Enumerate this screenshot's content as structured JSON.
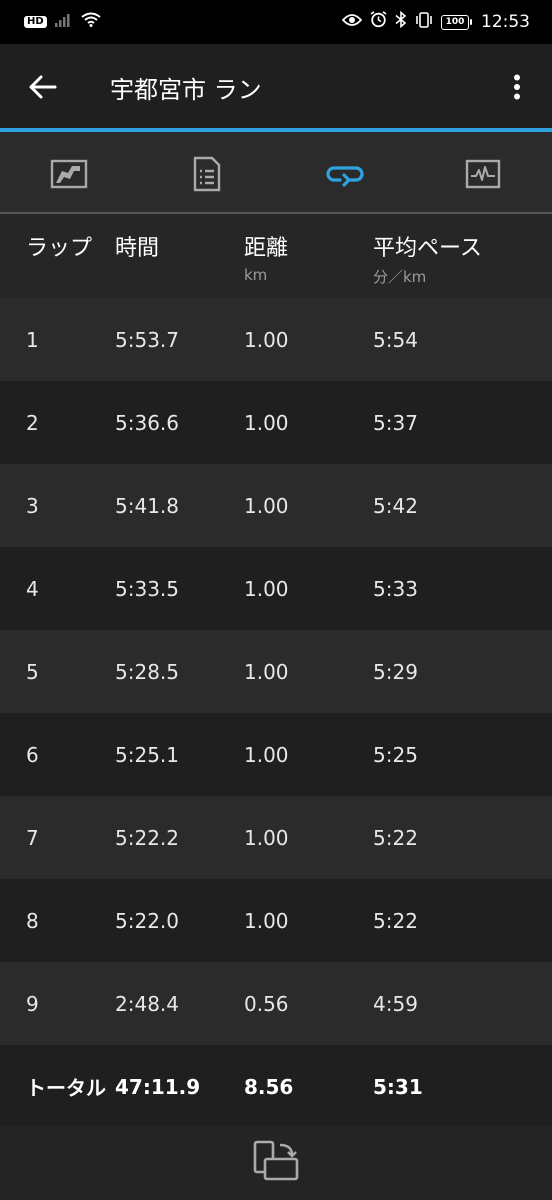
{
  "status_bar": {
    "hd": "HD",
    "battery": "100",
    "time": "12:53"
  },
  "app_bar": {
    "title": "宇都宮市 ラン",
    "icons": [
      "arrow-left",
      "more-vertical"
    ]
  },
  "tabs": [
    {
      "icon": "map-icon",
      "active": false
    },
    {
      "icon": "details-icon",
      "active": false
    },
    {
      "icon": "laps-icon",
      "active": true
    },
    {
      "icon": "chart-icon",
      "active": false
    }
  ],
  "colors": {
    "accent": "#2ea3e0",
    "row_odd": "#2b2b2b",
    "row_even": "#1f1f1f"
  },
  "table": {
    "headers": {
      "lap": "ラップ",
      "time": "時間",
      "distance": "距離",
      "distance_unit": "km",
      "pace": "平均ペース",
      "pace_unit": "分／km"
    },
    "rows": [
      {
        "lap": "1",
        "time": "5:53.7",
        "distance": "1.00",
        "pace": "5:54"
      },
      {
        "lap": "2",
        "time": "5:36.6",
        "distance": "1.00",
        "pace": "5:37"
      },
      {
        "lap": "3",
        "time": "5:41.8",
        "distance": "1.00",
        "pace": "5:42"
      },
      {
        "lap": "4",
        "time": "5:33.5",
        "distance": "1.00",
        "pace": "5:33"
      },
      {
        "lap": "5",
        "time": "5:28.5",
        "distance": "1.00",
        "pace": "5:29"
      },
      {
        "lap": "6",
        "time": "5:25.1",
        "distance": "1.00",
        "pace": "5:25"
      },
      {
        "lap": "7",
        "time": "5:22.2",
        "distance": "1.00",
        "pace": "5:22"
      },
      {
        "lap": "8",
        "time": "5:22.0",
        "distance": "1.00",
        "pace": "5:22"
      },
      {
        "lap": "9",
        "time": "2:48.4",
        "distance": "0.56",
        "pace": "4:59"
      }
    ],
    "total": {
      "lap": "トータル",
      "time": "47:11.9",
      "distance": "8.56",
      "pace": "5:31"
    }
  },
  "bottom_bar": {
    "icon": "rotate-screen-icon"
  }
}
